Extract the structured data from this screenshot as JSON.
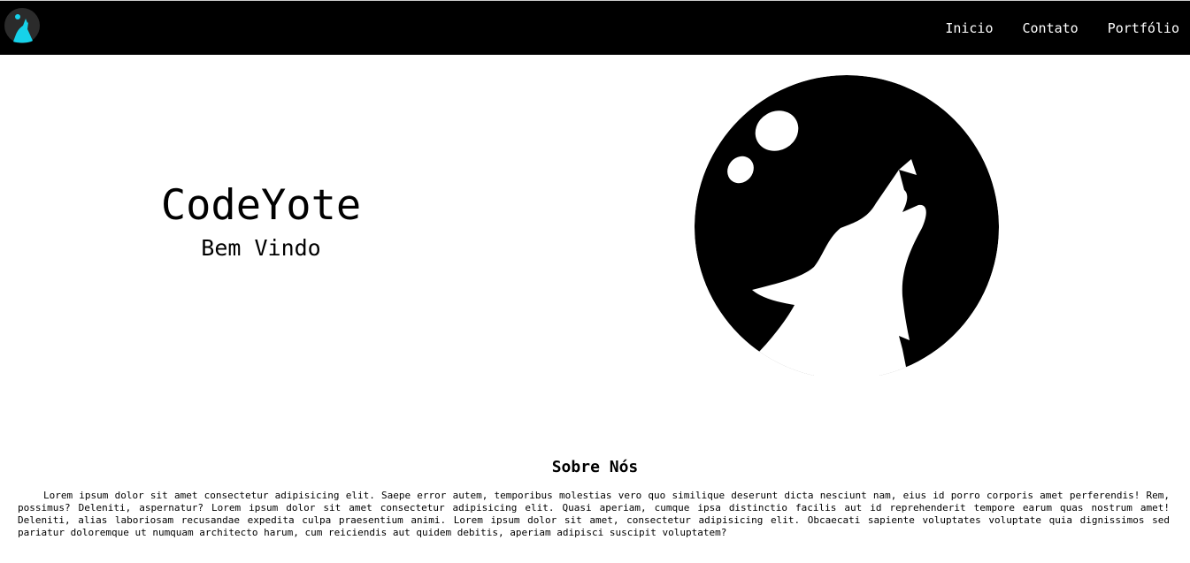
{
  "navbar": {
    "logo_icon": "howling-wolf-moon-logo-icon",
    "links": [
      {
        "label": "Inicio"
      },
      {
        "label": "Contato"
      },
      {
        "label": "Portfólio"
      }
    ]
  },
  "hero": {
    "title": "CodeYote",
    "subtitle": "Bem Vindo",
    "image_icon": "howling-wolf-moon-icon"
  },
  "about": {
    "title": "Sobre Nós",
    "text": "Lorem ipsum dolor sit amet consectetur adipisicing elit. Saepe error autem, temporibus molestias vero quo similique deserunt dicta nesciunt nam, eius id porro corporis amet perferendis! Rem, possimus? Deleniti, aspernatur? Lorem ipsum dolor sit amet consectetur adipisicing elit. Quasi aperiam, cumque ipsa distinctio facilis aut id reprehenderit tempore earum quas nostrum amet! Deleniti, alias laboriosam recusandae expedita culpa praesentium animi. Lorem ipsum dolor sit amet, consectetur adipisicing elit. Obcaecati sapiente voluptates voluptate quia dignissimos sed pariatur doloremque ut numquam architecto harum, cum reiciendis aut quidem debitis, aperiam adipisci suscipit voluptatem?"
  },
  "colors": {
    "navbar_bg": "#000000",
    "logo_bg": "#2b2b2b",
    "logo_accent": "#16d2ea",
    "page_bg": "#ffffff"
  }
}
